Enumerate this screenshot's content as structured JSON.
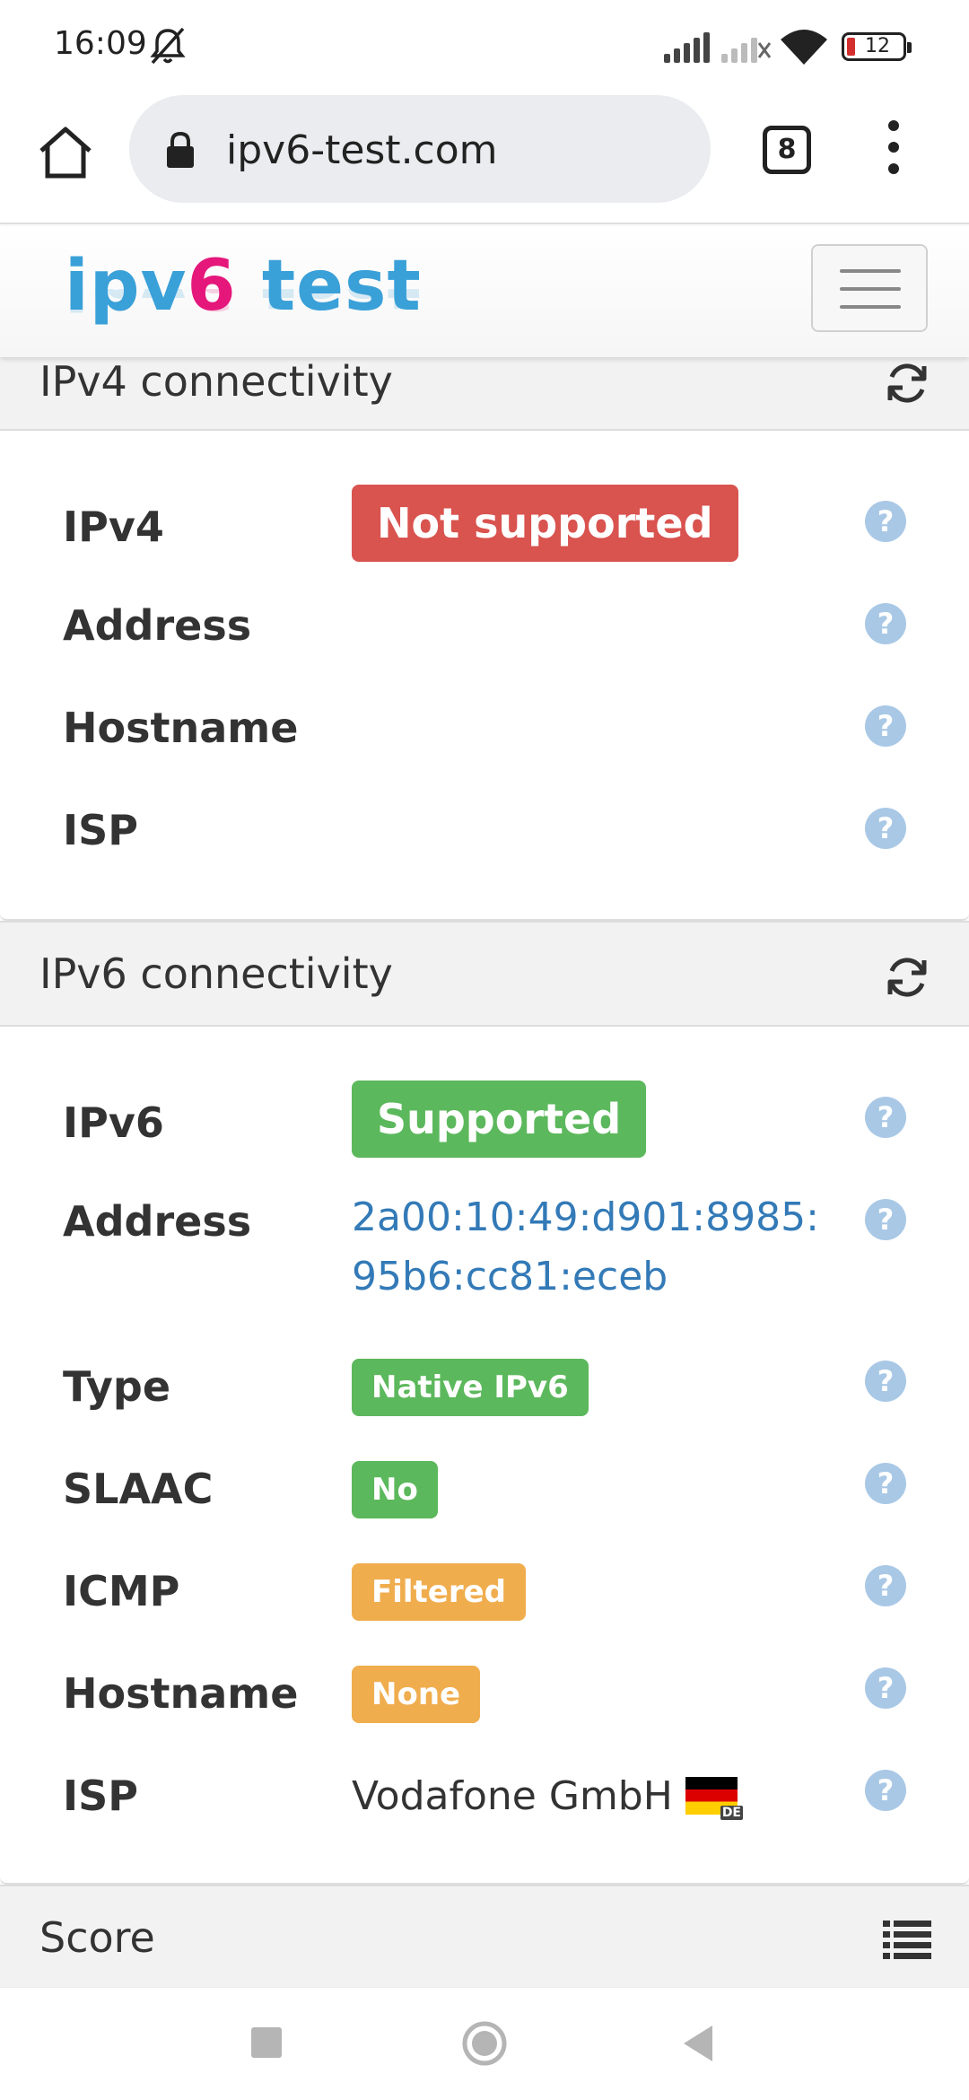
{
  "status_bar": {
    "time": "16:09",
    "battery": "12"
  },
  "browser": {
    "url": "ipv6-test.com",
    "tab_count": "8"
  },
  "site": {
    "logo_part1": "ipv",
    "logo_part2": "6",
    "logo_part3": " test"
  },
  "ipv4_panel": {
    "title": "IPv4 connectivity",
    "rows": [
      {
        "label": "IPv4",
        "value": "Not supported"
      },
      {
        "label": "Address",
        "value": ""
      },
      {
        "label": "Hostname",
        "value": ""
      },
      {
        "label": "ISP",
        "value": ""
      }
    ]
  },
  "ipv6_panel": {
    "title": "IPv6 connectivity",
    "rows": [
      {
        "label": "IPv6",
        "value": "Supported"
      },
      {
        "label": "Address",
        "value_line1": "2a00:10:49:d901:8985:",
        "value_line2": "95b6:cc81:eceb"
      },
      {
        "label": "Type",
        "value": "Native IPv6"
      },
      {
        "label": "SLAAC",
        "value": "No"
      },
      {
        "label": "ICMP",
        "value": "Filtered"
      },
      {
        "label": "Hostname",
        "value": "None"
      },
      {
        "label": "ISP",
        "value": "Vodafone GmbH",
        "flag_cc": "DE"
      }
    ]
  },
  "score_panel": {
    "title": "Score"
  },
  "help_glyph": "?",
  "colors": {
    "danger": "#d9534f",
    "success": "#5cb85c",
    "warning": "#f0ad4e",
    "link": "#337ab7",
    "help": "#a9c8e6"
  }
}
